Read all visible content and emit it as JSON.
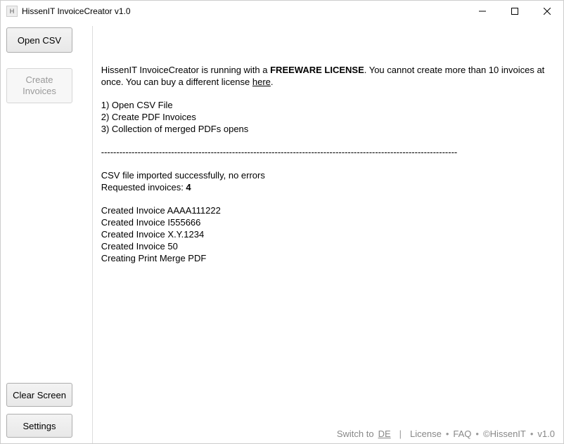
{
  "window": {
    "title": "HissenIT InvoiceCreator v1.0",
    "app_icon_label": "H"
  },
  "sidebar": {
    "open_csv": "Open CSV",
    "create_invoices": "Create\nInvoices",
    "clear_screen": "Clear Screen",
    "settings": "Settings"
  },
  "log": {
    "license_prefix": "HissenIT InvoiceCreator is running with a ",
    "license_bold": "FREEWARE LICENSE",
    "license_suffix": ". You cannot create more than 10 invoices at once. You can buy a different license ",
    "license_here": "here",
    "license_end": ".",
    "steps": [
      "1) Open CSV File",
      "2) Create PDF Invoices",
      "3) Collection of merged PDFs opens"
    ],
    "separator": "---------------------------------------------------------------------------------------------------------------------",
    "import_msg": "CSV file imported successfully, no errors",
    "requested_prefix": "Requested invoices: ",
    "requested_count": "4",
    "created_lines": [
      "Created Invoice AAAA111222",
      "Created Invoice I555666",
      "Created Invoice X.Y.1234",
      "Created Invoice 50",
      "Creating Print Merge PDF"
    ]
  },
  "footer": {
    "switch_pre": "Switch to ",
    "switch_lang": "DE",
    "license": "License",
    "faq": "FAQ",
    "copyright": "©HissenIT",
    "version": "v1.0",
    "pipe": "|",
    "bullet": "•"
  }
}
